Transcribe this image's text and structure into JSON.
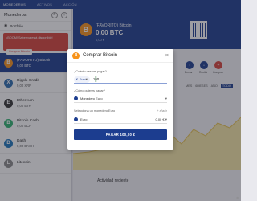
{
  "topnav": {
    "tabs": [
      "MONEDEROS",
      "ACTIVOS",
      "ACCIÓN"
    ]
  },
  "sidebar": {
    "title": "Monederos",
    "portfolio": "Portfolio",
    "promo": {
      "message": "¡BOOM! Saber ya está disponible!",
      "button": "Comprar Bitcoin"
    },
    "assets": [
      {
        "name": "(FAVORITO) Bitcoin",
        "value": "0,00 BTC",
        "icon": "B",
        "color": "#f7931a",
        "active": true
      },
      {
        "name": "Ripple Credit",
        "value": "0,00 XRP",
        "icon": "X",
        "color": "#2b6cb0",
        "active": false
      },
      {
        "name": "Ethereum",
        "value": "0,00 ETH",
        "icon": "E",
        "color": "#333333",
        "active": false
      },
      {
        "name": "Bitcoin Cash",
        "value": "0,00 BCH",
        "icon": "B",
        "color": "#2fb36f",
        "active": false
      },
      {
        "name": "Dash",
        "value": "0,00 DASH",
        "icon": "D",
        "color": "#1c75bc",
        "active": false
      },
      {
        "name": "Litecoin",
        "value": "",
        "icon": "L",
        "color": "#8a8a8a",
        "active": false
      }
    ]
  },
  "main": {
    "wallet_name": "(FAVORITO) Bitcoin",
    "balance": "0,00 BTC",
    "balance_eur": "0,00 €",
    "actions": [
      {
        "label": "Enviar",
        "icon": "↑",
        "red": false
      },
      {
        "label": "Recibir",
        "icon": "↓",
        "red": false
      },
      {
        "label": "Comprar",
        "icon": "+",
        "red": true
      }
    ],
    "periods": [
      "MES",
      "6MESES",
      "AÑO",
      "TODO"
    ],
    "recent_activity": "Actividad reciente"
  },
  "modal": {
    "title": "Comprar Bitcoin",
    "close": "×",
    "amount_label": "¿Cuánto deseas pagar?",
    "currency_label": "Euro",
    "currency_symbol": "€",
    "amount_value": "100",
    "method_label": "¿Cómo quieres pagar?",
    "method_value": "Monedero Euro",
    "wallet_label": "Selecciona un monedero Euro",
    "wallet_hint": "+ añadir",
    "wallet_value": "Euro",
    "wallet_balance": "0,00 €",
    "pay_button": "PAGAR 100,00 €"
  },
  "colors": {
    "brand": "#1c3d8f",
    "accent_red": "#d8423a",
    "bitcoin": "#f7931a"
  }
}
